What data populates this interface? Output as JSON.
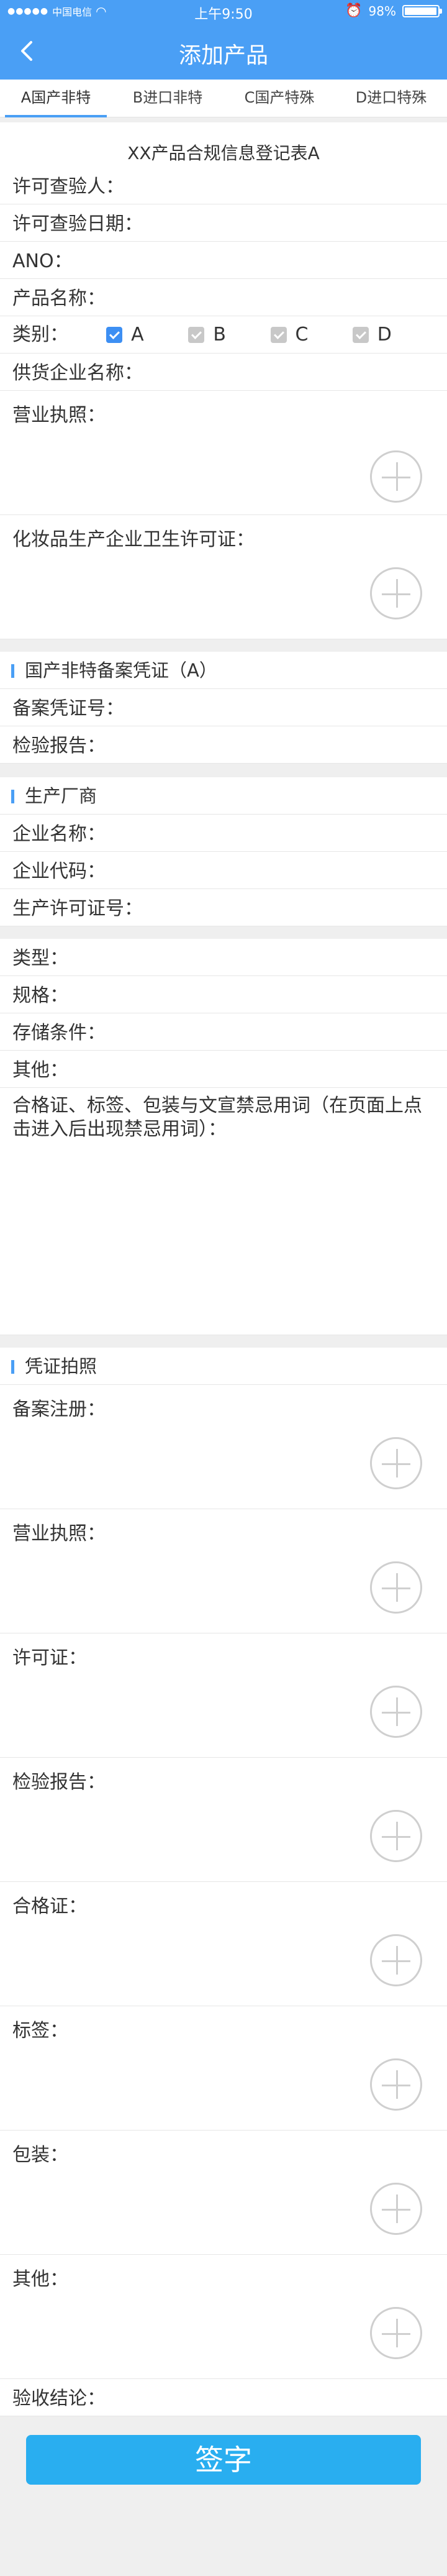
{
  "status_bar": {
    "carrier": "中国电信",
    "time": "上午9:50",
    "battery": "98%",
    "battery_level": 0.98
  },
  "header": {
    "title": "添加产品"
  },
  "tabs": [
    {
      "label": "A国产非特",
      "active": true
    },
    {
      "label": "B进口非特",
      "active": false
    },
    {
      "label": "C国产特殊",
      "active": false
    },
    {
      "label": "D进口特殊",
      "active": false
    }
  ],
  "form_title": "XX产品合规信息登记表A",
  "basic": {
    "inspector": "许可查验人：",
    "inspect_date": "许可查验日期：",
    "ano": "ANO：",
    "product_name": "产品名称：",
    "category_label": "类别：",
    "categories": [
      {
        "label": "A",
        "checked": true
      },
      {
        "label": "B",
        "checked": true
      },
      {
        "label": "C",
        "checked": true
      },
      {
        "label": "D",
        "checked": true
      }
    ],
    "supplier": "供货企业名称：",
    "business_license": "营业执照：",
    "hygiene_license": "化妆品生产企业卫生许可证："
  },
  "filing_section": {
    "title": "国产非特备案凭证（A）",
    "cert_no": "备案凭证号：",
    "report": "检验报告："
  },
  "maker_section": {
    "title": "生产厂商",
    "company": "企业名称：",
    "code": "企业代码：",
    "license_no": "生产许可证号："
  },
  "product_info": {
    "type": "类型：",
    "spec": "规格：",
    "storage": "存储条件：",
    "other": "其他：",
    "banned_words": "合格证、标签、包装与文宣禁忌用词（在页面上点击进入后出现禁忌用词）："
  },
  "photos_section": {
    "title": "凭证拍照",
    "items": [
      "备案注册：",
      "营业执照：",
      "许可证：",
      "检验报告：",
      "合格证：",
      "标签：",
      "包装：",
      "其他："
    ]
  },
  "conclusion": "验收结论：",
  "sign_button": "签字"
}
